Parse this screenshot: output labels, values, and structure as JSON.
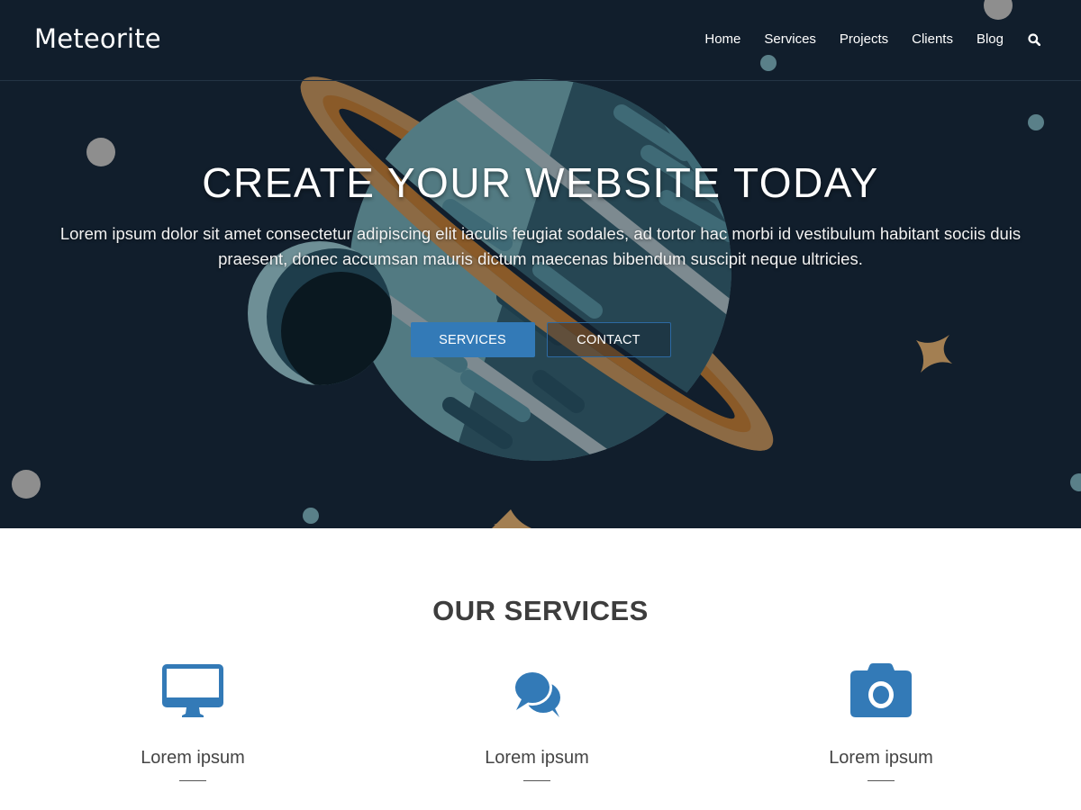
{
  "brand": {
    "name": "Meteorite"
  },
  "nav": {
    "items": [
      {
        "label": "Home"
      },
      {
        "label": "Services"
      },
      {
        "label": "Projects"
      },
      {
        "label": "Clients"
      },
      {
        "label": "Blog"
      }
    ],
    "search_icon": "search-icon"
  },
  "hero": {
    "title": "CREATE YOUR WEBSITE TODAY",
    "text": "Lorem ipsum dolor sit amet consectetur adipiscing elit iaculis feugiat sodales, ad tortor hac morbi id vestibulum habitant sociis duis praesent, donec accumsan mauris dictum maecenas bibendum suscipit neque ultricies.",
    "buttons": {
      "primary": "SERVICES",
      "secondary": "CONTACT"
    }
  },
  "services": {
    "title": "OUR SERVICES",
    "items": [
      {
        "icon": "desktop-icon",
        "label": "Lorem ipsum"
      },
      {
        "icon": "comments-icon",
        "label": "Lorem ipsum"
      },
      {
        "icon": "camera-icon",
        "label": "Lorem ipsum"
      }
    ]
  },
  "colors": {
    "hero_bg": "#111e2c",
    "accent": "#337ab7",
    "planet_light": "#527a82",
    "planet_dark": "#1e3d4b",
    "ring": "#8c6a44",
    "ring_inner": "#8a5a28",
    "star": "#a37f52",
    "dot_grey": "#8e8e8e",
    "dot_teal": "#5a8089"
  }
}
